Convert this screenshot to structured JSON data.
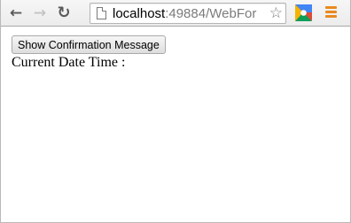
{
  "browser": {
    "address_bar": {
      "host": "localhost",
      "path": ":49884/WebFor"
    },
    "icons": {
      "back": "back-arrow-icon",
      "forward": "forward-arrow-icon",
      "reload": "reload-icon",
      "page": "page-icon",
      "bookmark": "star-icon",
      "extension": "extension-icon",
      "menu": "menu-icon"
    },
    "colors": {
      "menu_accent": "#e98a1c"
    }
  },
  "page": {
    "confirm_button_label": "Show Confirmation Message",
    "datetime_label": "Current Date Time :"
  }
}
